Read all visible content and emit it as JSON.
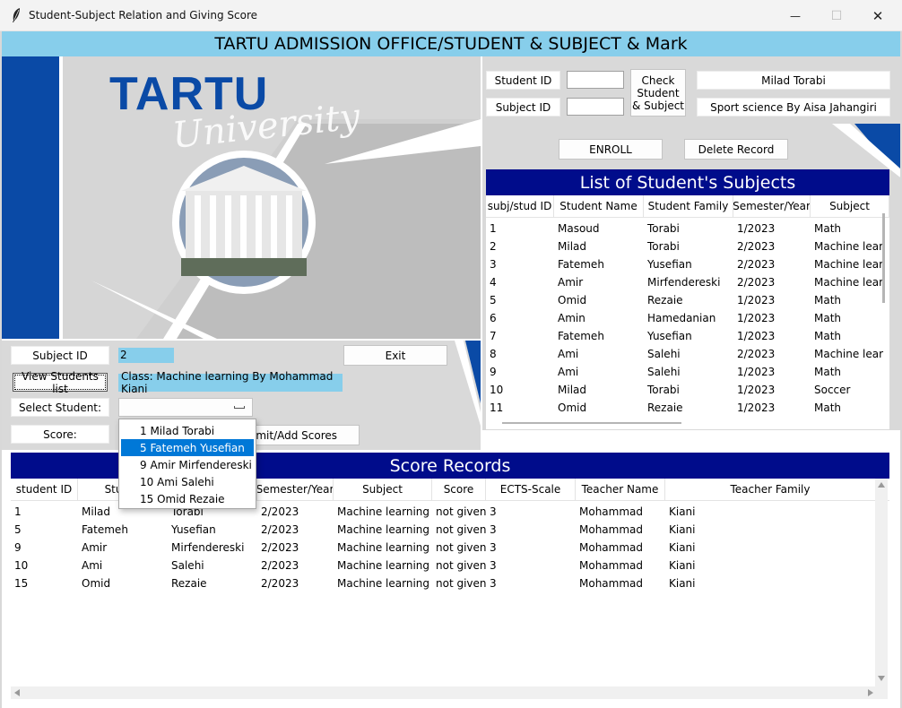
{
  "window": {
    "title": "Student-Subject Relation and Giving Score",
    "minimize_glyph": "—",
    "maximize_glyph": "☐",
    "close_glyph": "✕"
  },
  "heading": "TARTU ADMISSION OFFICE/STUDENT & SUBJECT & Mark",
  "logo": {
    "text": "TARTU",
    "script": "University"
  },
  "enroll_form": {
    "student_id_label": "Student ID",
    "subject_id_label": "Subject ID",
    "student_id_value": "",
    "subject_id_value": "",
    "check_button": "Check\nStudent\n& Subject",
    "student_name_display": "Milad  Torabi",
    "subject_display": "Sport science  By  Aisa Jahangiri",
    "enroll_button": "ENROLL",
    "delete_button": "Delete Record"
  },
  "subjects_table": {
    "title": "List of Student's Subjects",
    "columns": [
      "subj/stud ID",
      "Student Name",
      "Student Family",
      "Semester/Year",
      "Subject"
    ],
    "rows": [
      [
        "1",
        "Masoud",
        "Torabi",
        "1/2023",
        "Math"
      ],
      [
        "2",
        "Milad",
        "Torabi",
        "2/2023",
        "Machine lear"
      ],
      [
        "3",
        "Fatemeh",
        "Yusefian",
        "2/2023",
        "Machine lear"
      ],
      [
        "4",
        "Amir",
        "Mirfendereski",
        "2/2023",
        "Machine lear"
      ],
      [
        "5",
        "Omid",
        "Rezaie",
        "1/2023",
        "Math"
      ],
      [
        "6",
        "Amin",
        "Hamedanian",
        "1/2023",
        "Math"
      ],
      [
        "7",
        "Fatemeh",
        "Yusefian",
        "1/2023",
        "Math"
      ],
      [
        "8",
        "Ami",
        "Salehi",
        "2/2023",
        "Machine lear"
      ],
      [
        "9",
        "Ami",
        "Salehi",
        "1/2023",
        "Math"
      ],
      [
        "10",
        "Milad",
        "Torabi",
        "1/2023",
        "Soccer"
      ],
      [
        "11",
        "Omid",
        "Rezaie",
        "1/2023",
        "Math"
      ]
    ]
  },
  "score_form": {
    "subject_id_label": "Subject ID",
    "subject_id_value": "2",
    "exit_button": "Exit",
    "view_students_button": "View Students list",
    "class_info": "Class: Machine learning  By  Mohammad Kiani",
    "select_student_label": "Select Student:",
    "select_value": "",
    "score_label": "Score:",
    "submit_button": "Submit/Add Scores",
    "submit_visible_text": "omit/Add Scores"
  },
  "dropdown": {
    "options": [
      "1 Milad Torabi",
      "5 Fatemeh Yusefian",
      "9 Amir Mirfendereski",
      "10 Ami Salehi",
      "15 Omid Rezaie"
    ],
    "selected_index": 1
  },
  "score_table": {
    "title": "Score Records",
    "columns": [
      "student ID",
      "Studer",
      "",
      "Semester/Year",
      "Subject",
      "Score",
      "ECTS-Scale",
      "Teacher Name",
      "Teacher Family"
    ],
    "rows": [
      [
        "1",
        "Milad",
        "Torabi",
        "2/2023",
        "Machine learning",
        "not given",
        "3",
        "Mohammad",
        "Kiani"
      ],
      [
        "5",
        "Fatemeh",
        "Yusefian",
        "2/2023",
        "Machine learning",
        "not given",
        "3",
        "Mohammad",
        "Kiani"
      ],
      [
        "9",
        "Amir",
        "Mirfendereski",
        "2/2023",
        "Machine learning",
        "not given",
        "3",
        "Mohammad",
        "Kiani"
      ],
      [
        "10",
        "Ami",
        "Salehi",
        "2/2023",
        "Machine learning",
        "not given",
        "3",
        "Mohammad",
        "Kiani"
      ],
      [
        "15",
        "Omid",
        "Rezaie",
        "2/2023",
        "Machine learning",
        "not given",
        "3",
        "Mohammad",
        "Kiani"
      ]
    ]
  },
  "colors": {
    "heading_bg": "#87ceeb",
    "table_title_bg": "#000c8b",
    "accent_blue": "#0a4aa6",
    "selection": "#0078d7"
  }
}
